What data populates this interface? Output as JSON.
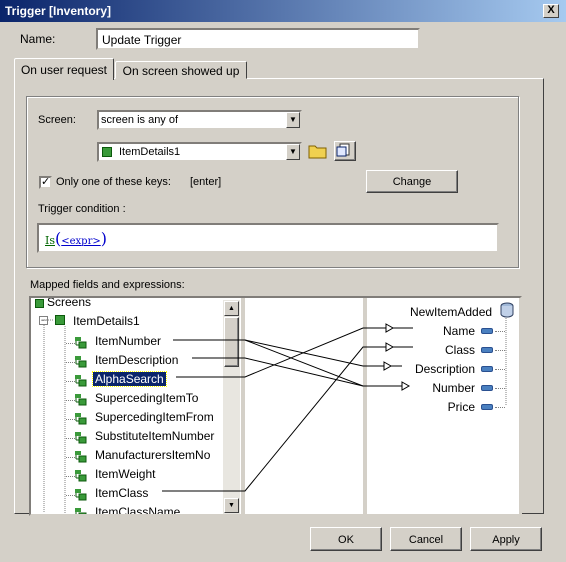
{
  "window": {
    "title": "Trigger [Inventory]",
    "close_label": "X"
  },
  "name_label": "Name:",
  "name_value": "Update Trigger",
  "tabs": [
    {
      "label": "On user request",
      "active": true
    },
    {
      "label": "On screen showed up",
      "active": false
    }
  ],
  "screen_label": "Screen:",
  "screen_mode": "screen is any of",
  "screen_value": "ItemDetails1",
  "only_keys_label": "Only one of these keys:",
  "only_keys_checked": true,
  "keys_value": "[enter]",
  "change_label": "Change",
  "trigger_condition_label": "Trigger condition :",
  "condition": {
    "func": "Is",
    "open": "(",
    "arg": "<expr>",
    "close": ")"
  },
  "mapped_label": "Mapped fields and expressions:",
  "tree": {
    "root": "Screens",
    "screen": "ItemDetails1",
    "items": [
      "ItemNumber",
      "ItemDescription",
      "AlphaSearch",
      "SupercedingItemTo",
      "SupercedingItemFrom",
      "SubstituteItemNumber",
      "ManufacturersItemNo",
      "ItemWeight",
      "ItemClass",
      "ItemClassName"
    ],
    "selected": "AlphaSearch"
  },
  "target": {
    "title": "NewItemAdded",
    "fields": [
      "Name",
      "Class",
      "Description",
      "Number",
      "Price"
    ]
  },
  "buttons": {
    "ok": "OK",
    "cancel": "Cancel",
    "apply": "Apply"
  },
  "colors": {
    "title_start": "#0a246a",
    "title_end": "#a6caf0",
    "selection": "#0a246a",
    "link_green": "#006600",
    "link_blue": "#0000cc"
  }
}
